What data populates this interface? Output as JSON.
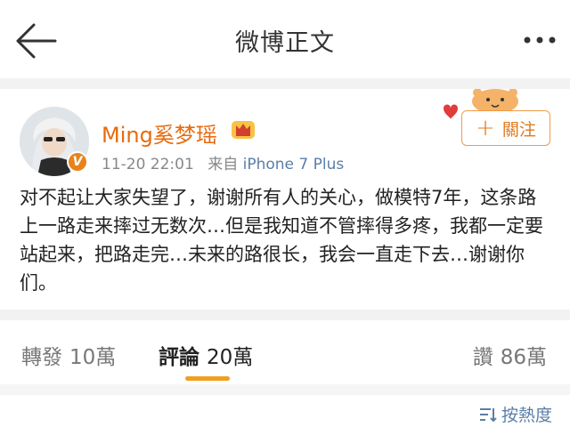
{
  "nav": {
    "title": "微博正文",
    "back_icon": "arrow-left-icon",
    "more_icon": "more-dots-icon"
  },
  "post": {
    "username": "Ming奚梦瑶",
    "verified_badge": "V",
    "time": "11-20 22:01",
    "source_prefix": "来自",
    "source": "iPhone 7 Plus",
    "follow_label": "關注",
    "content": "对不起让大家失望了，谢谢所有人的关心，做模特7年，这条路上一路走来摔过无数次…但是我知道不管摔得多疼，我都一定要站起来，把路走完…未来的路很长，我会一直走下去…谢谢你们。"
  },
  "tabs": [
    {
      "label": "轉發",
      "count": "10萬"
    },
    {
      "label": "評論",
      "count": "20萬",
      "active": true
    },
    {
      "label": "讚",
      "count": "86萬"
    }
  ],
  "sort": {
    "label": "按熱度"
  },
  "colors": {
    "username": "#e86b0d",
    "accent": "#f0a020",
    "link": "#5b7ea8"
  }
}
